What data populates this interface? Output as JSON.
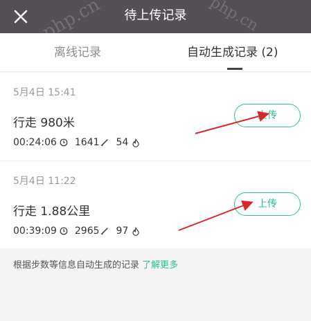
{
  "header": {
    "title": "待上传记录",
    "close_icon": "close-icon",
    "watermark": "php.cn"
  },
  "tabs": [
    {
      "label": "离线记录",
      "active": false
    },
    {
      "label": "自动生成记录 (2)",
      "active": true
    }
  ],
  "records": [
    {
      "date": "5月4日 15:41",
      "distance": "行走 980米",
      "duration": "00:24:06",
      "steps": "1641",
      "calories": "54",
      "upload_label": "上传"
    },
    {
      "date": "5月4日 11:22",
      "distance": "行走 1.88公里",
      "duration": "00:39:09",
      "steps": "2965",
      "calories": "97",
      "upload_label": "上传"
    }
  ],
  "footer": {
    "note": "根据步数等信息自动生成的记录",
    "link": "了解更多"
  },
  "colors": {
    "header_bg": "#555056",
    "accent": "#28c28c",
    "arrow": "#d9262a"
  },
  "icons": [
    "clock-icon",
    "footprint-icon",
    "flame-icon"
  ]
}
